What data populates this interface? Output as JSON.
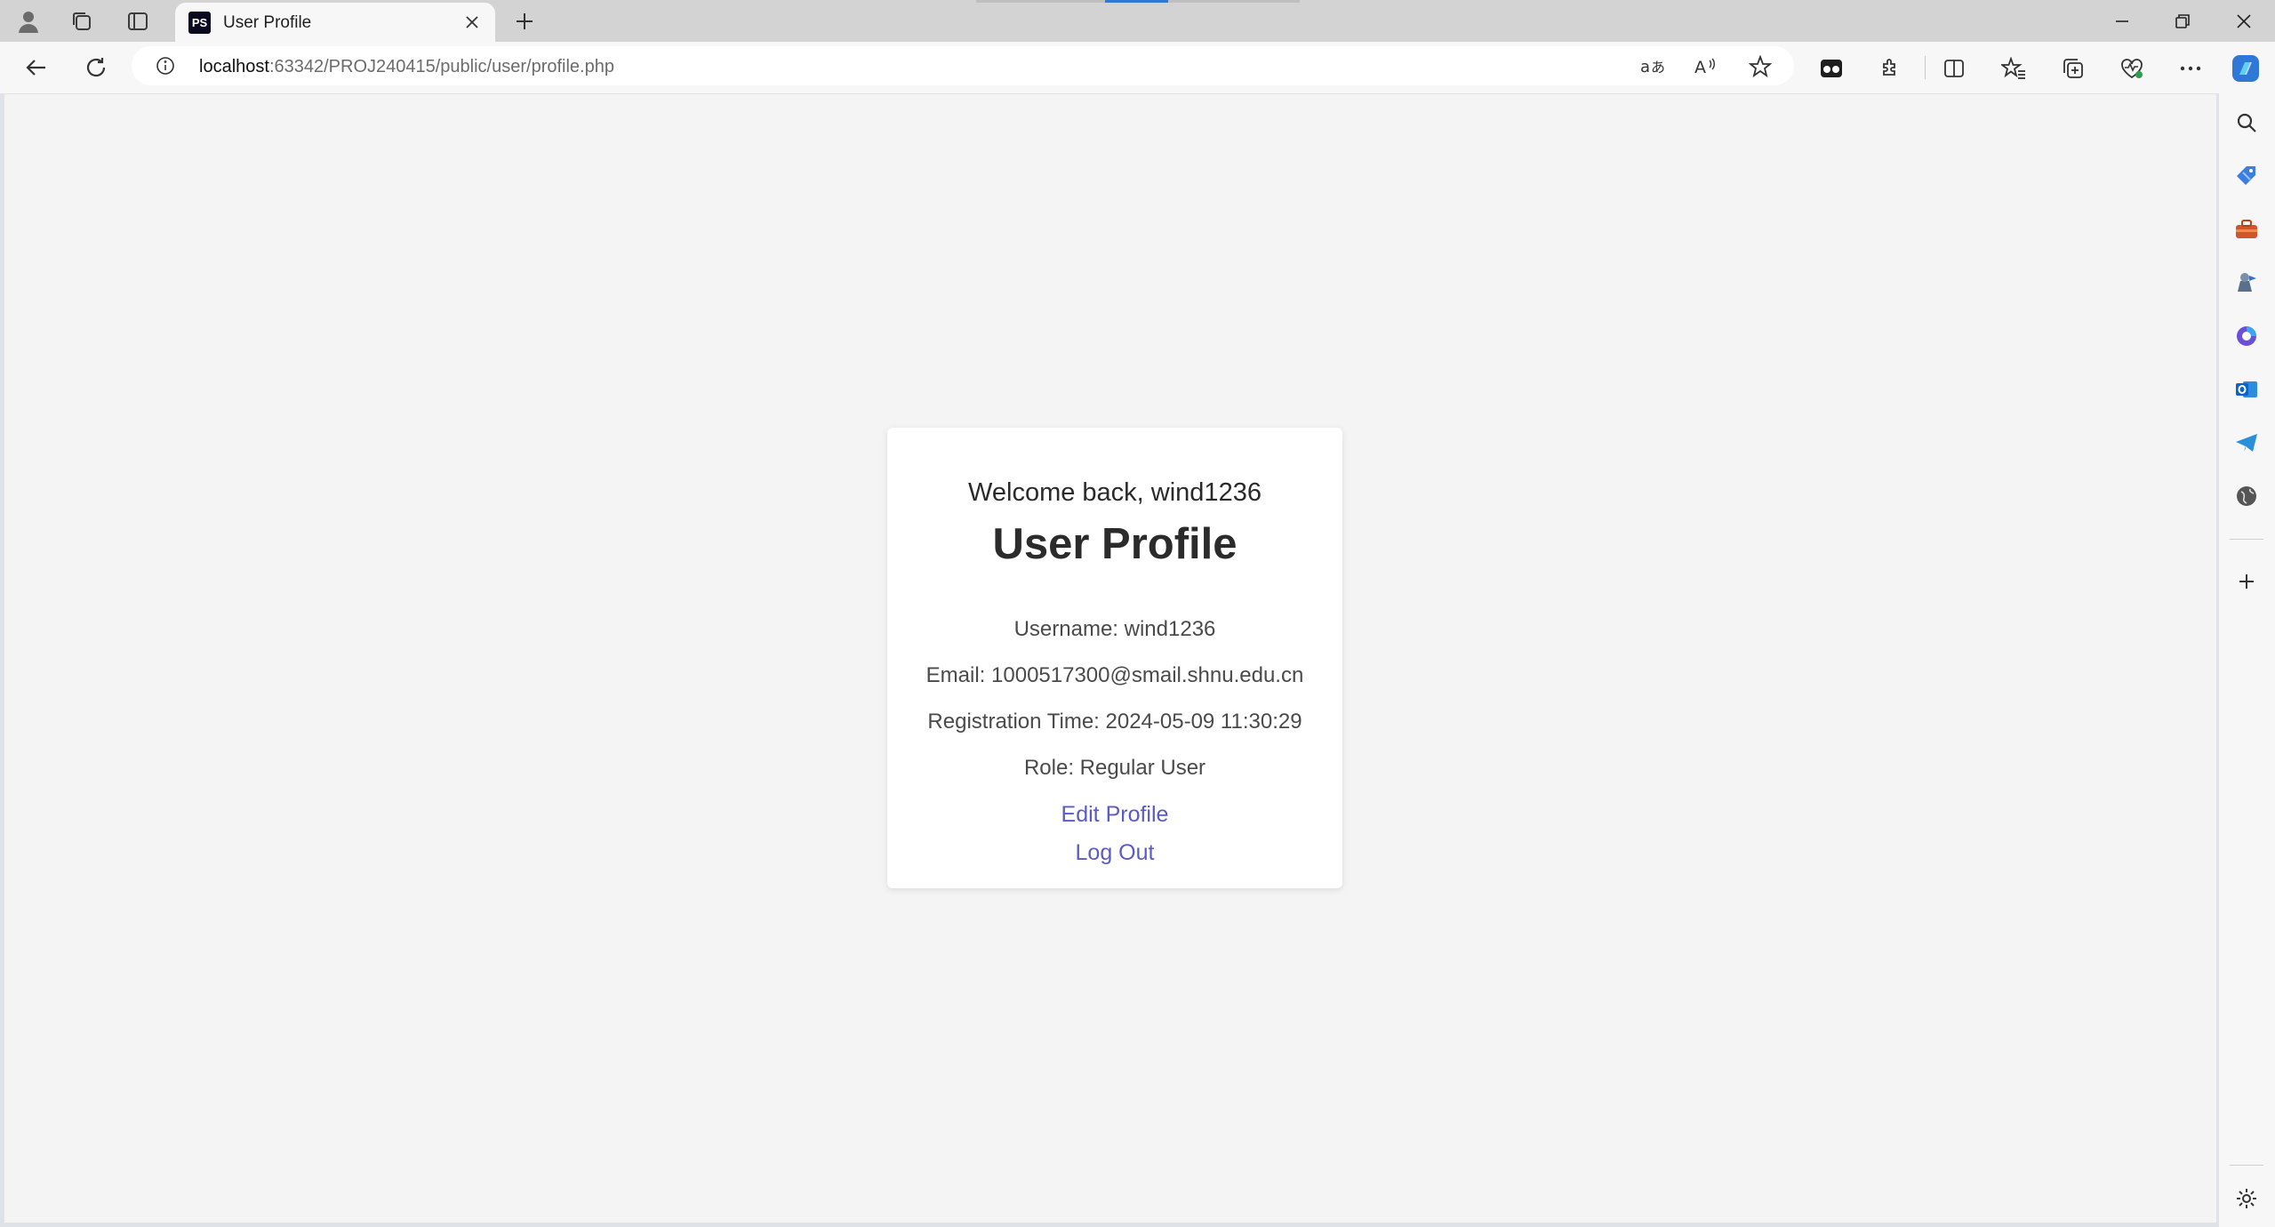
{
  "browser": {
    "tab": {
      "title": "User Profile",
      "favicon_text": "PS"
    },
    "address": {
      "host": "localhost",
      "rest": ":63342/PROJ240415/public/user/profile.php"
    }
  },
  "profile": {
    "welcome": "Welcome back, wind1236",
    "title": "User Profile",
    "username": "Username: wind1236",
    "email": "Email: 1000517300@smail.shnu.edu.cn",
    "registration": "Registration Time: 2024-05-09 11:30:29",
    "role": "Role: Regular User",
    "edit_link": "Edit Profile",
    "logout_link": "Log Out"
  },
  "colors": {
    "link": "#5b5bc4",
    "page_bg": "#f4f4f4",
    "card_bg": "#ffffff",
    "copilot_accent": "#2f78d8"
  },
  "icons": {
    "tabstrip": [
      "profile-icon",
      "workspaces-icon",
      "tab-actions-icon",
      "close-icon",
      "new-tab-icon"
    ],
    "window": [
      "minimize-icon",
      "restore-icon",
      "close-icon"
    ],
    "toolbar": [
      "back-icon",
      "refresh-icon",
      "info-icon",
      "translate-icon",
      "read-aloud-icon",
      "favorite-star-icon",
      "extension-icon",
      "extensions-icon",
      "split-screen-icon",
      "favorites-icon",
      "collections-icon",
      "browser-essentials-icon",
      "more-icon",
      "copilot-icon"
    ],
    "sidebar": [
      "search-icon",
      "shopping-tag-icon",
      "tools-icon",
      "games-icon",
      "microsoft-365-icon",
      "outlook-icon",
      "telegram-icon",
      "globe-icon",
      "add-icon",
      "settings-icon"
    ]
  }
}
